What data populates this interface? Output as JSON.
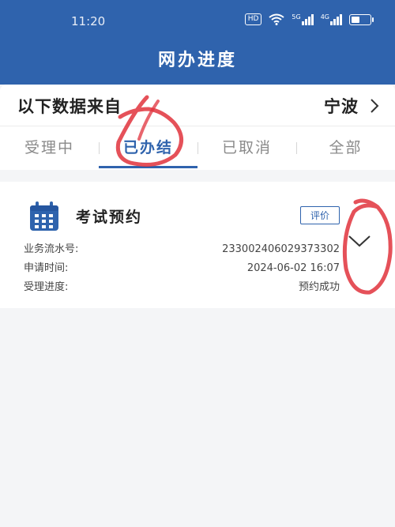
{
  "status_bar": {
    "time": "11:20",
    "hd_badge": "HD",
    "network_5g": "5G",
    "network_4g": "4G",
    "battery_level": 0.5
  },
  "header": {
    "title": "网办进度"
  },
  "source": {
    "label": "以下数据来自",
    "city": "宁波"
  },
  "tabs": [
    {
      "label": "受理中",
      "active": false
    },
    {
      "label": "已办结",
      "active": true
    },
    {
      "label": "已取消",
      "active": false
    },
    {
      "label": "全部",
      "active": false
    }
  ],
  "card": {
    "title": "考试预约",
    "rate_label": "评价",
    "rows": [
      {
        "label": "业务流水号:",
        "value": "233002406029373302"
      },
      {
        "label": "申请时间:",
        "value": "2024-06-02 16:07"
      },
      {
        "label": "受理进度:",
        "value": "预约成功"
      }
    ]
  },
  "colors": {
    "primary": "#2f63ad",
    "annotation": "#e0323c"
  },
  "icons": [
    "wifi-icon",
    "calendar-icon",
    "chevron-right-icon",
    "chevron-down-icon"
  ]
}
